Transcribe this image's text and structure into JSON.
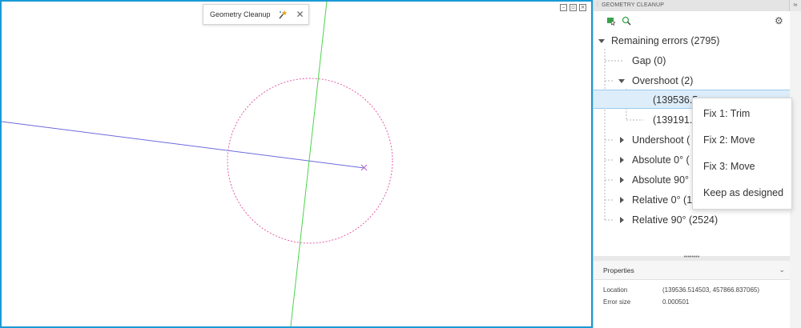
{
  "toolbar": {
    "title": "Geometry Cleanup",
    "wand_icon": "magic-wand-icon",
    "close_icon": "close-icon"
  },
  "window_controls": [
    "minimize-icon",
    "restore-icon",
    "close-icon"
  ],
  "panel": {
    "title": "GEOMETRY CLEANUP",
    "tools": [
      "select-errors-icon",
      "zoom-to-error-icon"
    ],
    "settings_icon": "gear-icon",
    "tree": {
      "root": "Remaining errors (2795)",
      "items": [
        {
          "label": "Gap (0)"
        },
        {
          "label": "Overshoot (2)"
        },
        {
          "label": "(139536.5"
        },
        {
          "label": "(139191.0"
        },
        {
          "label": "Undershoot ("
        },
        {
          "label": "Absolute 0° ("
        },
        {
          "label": "Absolute 90° ("
        },
        {
          "label": "Relative 0° (1"
        },
        {
          "label": "Relative 90° (2524)"
        }
      ]
    },
    "properties": {
      "title": "Properties",
      "rows": [
        {
          "name": "Location",
          "value": "(139536.514503, 457866.837065)"
        },
        {
          "name": "Error size",
          "value": "0.000501"
        }
      ]
    }
  },
  "context_menu": {
    "items": [
      "Fix 1: Trim",
      "Fix 2: Move",
      "Fix 3: Move",
      "Keep as designed"
    ]
  },
  "colors": {
    "viewport_border": "#1b9ad6",
    "selection_bg": "#ddedf9",
    "blue_line": "#6b6bdc",
    "green_line": "#4cd44c",
    "circle": "#e04da0"
  }
}
